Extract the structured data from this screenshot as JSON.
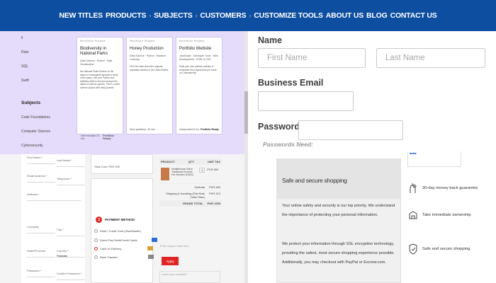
{
  "nav": {
    "items": [
      "NEW TITLES",
      "PRODUCTS",
      "SUBJECTS",
      "CUSTOMERS",
      "CUSTOMIZE TOOLS",
      "ABOUT US",
      "BLOG",
      "CONTACT US"
    ],
    "separator": "›"
  },
  "catalog": {
    "sidebar": {
      "rows": [
        "ll",
        "Rate",
        "SQL",
        "Swift"
      ],
      "subjects_heading": "Subjects",
      "subjects": [
        "Code Foundations",
        "Computer Science",
        "Cybersecurity"
      ]
    },
    "cards": [
      {
        "tag": "Portfolio Project",
        "title": "Biodiversity in National Parks",
        "sub": "Data Science · Python · Data Visualization",
        "desc": "the National Parks Service on the status of endangered species in some of the parks. Use your Python and statistics skills to find and analyze the status of various species. This is a data science project with many possibi",
        "foot_left": "Intermediate 20 hrs",
        "foot_right": "Portfolio Ready"
      },
      {
        "tag": "Portfolio Project",
        "title": "Honey Production",
        "sub": "Data Science · Python · Machine Learning",
        "desc": "Fill in the data about the regional population decline in the United States.",
        "foot_left": "More guidance, 40 min",
        "foot_right": ""
      },
      {
        "tag": "Portfolio Project",
        "title": "Portfolio Website",
        "sub": "JavaScript · Developer Tools · Web Development · HTML & CSS",
        "desc": "Build your own portfolio website to showcase the projects that you made on Codecademy!",
        "foot_left": "Independent 5 hrs",
        "foot_right": "Portfolio Ready"
      }
    ]
  },
  "checkout": {
    "fields": [
      "First Name *",
      "Last Name *",
      "Email Address *",
      "Telephone *",
      "Address *",
      "Company",
      "City *",
      "State/Province",
      "Country *",
      "Pakistan",
      "Password *",
      "Confirm Password *"
    ],
    "total_label": "Total Cost: PKR 209",
    "payment_number": "3",
    "payment_heading": "PAYMENT METHOD",
    "payment_options": [
      "Debit / Credit Card (Visa/Master)",
      "Direct Pay Debit/Credit Cards",
      "Cash on Delivery",
      "Bank Transfer"
    ],
    "order": {
      "columns": [
        "PRODUCT",
        "QTY",
        "UNIT TAX"
      ],
      "product": "Healthicious Onion Traditional Scones For Women (100G)",
      "qty": "1",
      "price": "PKR 899",
      "subtotal_label": "Subtotal",
      "subtotal": "PKR 899",
      "shipping_label": "Shipping & Handling (Flat Rate - Table Rate)",
      "shipping": "PKR 310",
      "grand_label": "GRAND TOTAL",
      "grand": "PKR 1209"
    },
    "coupon_placeholder": "Enter coupon code here",
    "apply_label": "Apply",
    "comment_placeholder": "Leave your comment"
  },
  "form": {
    "name_label": "Name",
    "first_placeholder": "First Name",
    "last_placeholder": "Last Name",
    "email_label": "Business Email",
    "password_label": "Password",
    "passwords_need": "Passwords Need:"
  },
  "safe": {
    "title": "Safe and secure shopping",
    "p1": "Your online safety and security is our top priority. We understand the importance of protecting your personal information.",
    "p2": "We protect your information through SSL encryption technology, providing the safest, most secure shopping experience possible. Additionally, you may checkout with PayPal or Escrow.com."
  },
  "trust": [
    {
      "icon": "money-back-icon",
      "label": "30-day money back guarantee"
    },
    {
      "icon": "ownership-icon",
      "label": "Take immediate ownership"
    },
    {
      "icon": "secure-shopping-icon",
      "label": "Safe and secure shopping"
    }
  ],
  "colors": {
    "nav_bg": "#0d4ea1",
    "lavender": "#e4dcfa",
    "accent_red": "#e02424"
  }
}
